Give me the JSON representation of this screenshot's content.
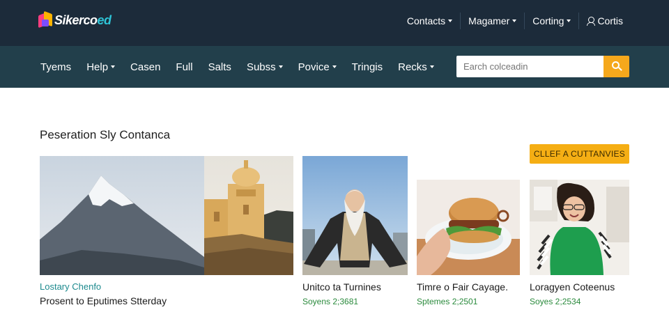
{
  "brand": {
    "name": "Sikerco",
    "suffix": "ed"
  },
  "topnav": [
    {
      "label": "Contacts",
      "has_dropdown": true
    },
    {
      "label": "Magamer",
      "has_dropdown": true
    },
    {
      "label": "Corting",
      "has_dropdown": true
    },
    {
      "label": "Cortis",
      "icon": "user-icon"
    }
  ],
  "mainnav": [
    {
      "label": "Tyems",
      "has_dropdown": false
    },
    {
      "label": "Help",
      "has_dropdown": true
    },
    {
      "label": "Casen",
      "has_dropdown": false
    },
    {
      "label": "Full",
      "has_dropdown": false
    },
    {
      "label": "Salts",
      "has_dropdown": false
    },
    {
      "label": "Subss",
      "has_dropdown": true
    },
    {
      "label": "Povice",
      "has_dropdown": true
    },
    {
      "label": "Tringis",
      "has_dropdown": false
    },
    {
      "label": "Recks",
      "has_dropdown": true
    }
  ],
  "search": {
    "placeholder": "Earch colceadin"
  },
  "section": {
    "title": "Peseration Sly Contanca",
    "cta": "CLLEF A CUTTANVIES"
  },
  "feature": {
    "kicker": "Lostary Chenfo",
    "title": "Prosent to Eputimes Stterday"
  },
  "cards": [
    {
      "title": "Unitco ta Turnines",
      "meta": "Soyens 2;3681",
      "image": "elderly-man-photo"
    },
    {
      "title": "Timre o Fair Cayage.",
      "meta": "Sptemes 2;2501",
      "image": "burger-photo"
    },
    {
      "title": "Loragyen Coteenus",
      "meta": "Soyes 2;2534",
      "image": "woman-photo"
    }
  ],
  "colors": {
    "topbar": "#1c2b3a",
    "mainnav": "#223f4b",
    "accent": "#f5a81c",
    "meta_green": "#2a8a3c",
    "kicker_teal": "#1d8a8e"
  }
}
